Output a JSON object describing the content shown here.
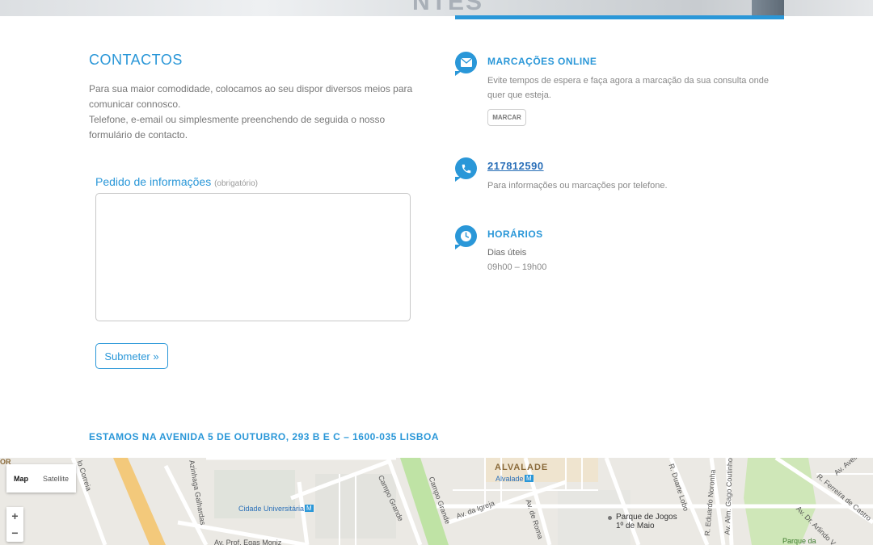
{
  "hero": {
    "partial_text": "NTES"
  },
  "contact": {
    "title": "CONTACTOS",
    "intro_line1": "Para sua maior comodidade, colocamos ao seu dispor diversos meios para comunicar connosco.",
    "intro_line2": "Telefone, e-email ou simplesmente preenchendo de seguida o nosso formulário de contacto."
  },
  "form": {
    "label": "Pedido de informações",
    "required_note": "(obrigatório)",
    "message_value": "",
    "submit_label": "Submeter »"
  },
  "online": {
    "title": "MARCAÇÕES ONLINE",
    "text": "Evite tempos de espera e faça agora a marcação da sua consulta onde quer que esteja.",
    "button_label": "MARCAR"
  },
  "phone": {
    "number": "217812590",
    "text": "Para informações ou marcações por telefone."
  },
  "hours": {
    "title": "HORÁRIOS",
    "days": "Dias úteis",
    "time": "09h00 – 19h00"
  },
  "address": "ESTAMOS NA AVENIDA 5 DE OUTUBRO, 293 B E C – 1600-035 LISBOA",
  "map": {
    "type_map": "Map",
    "type_satellite": "Satellite",
    "zoom_in": "+",
    "zoom_out": "−",
    "labels": {
      "alvalade": "ALVALADE",
      "alvalade_metro": "Alvalade",
      "cidade_universitaria": "Cidade Universitária",
      "parque": "Parque de Jogos",
      "parque2": "1º de Maio",
      "campo_grande": "Campo Grande",
      "campo_grande2": "Campo Grande",
      "av_igreja": "Av. da Igreja",
      "av_roma": "Av. de Roma",
      "azinhaga": "Azinhaga Galhardas",
      "correia": "lo Correia",
      "egas": "Av. Prof. Egas Moniz",
      "duarte": "R. Duarte Lobo",
      "eduardo": "R. Eduardo Noronha",
      "gago": "Av. Alm. Gago Coutinho",
      "avelino": "Av. Avelino Teixeira",
      "ferreira": "R. Ferreira de Castro",
      "arlindo": "Av. Dr. Arlindo V",
      "parque_da": "Parque da",
      "metro_m": "M",
      "or": "OR"
    }
  },
  "colors": {
    "accent": "#2a97d8",
    "phone_link": "#2a6fb8",
    "text": "#777777"
  }
}
